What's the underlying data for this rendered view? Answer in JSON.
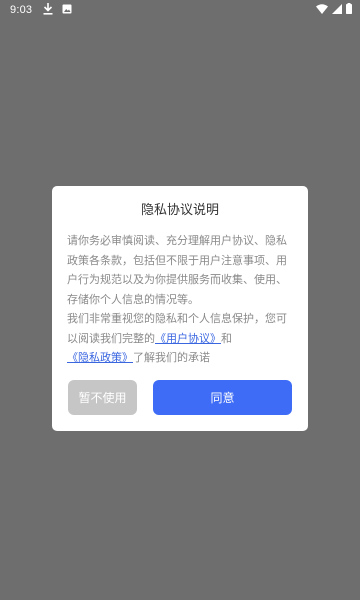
{
  "status_bar": {
    "time": "9:03",
    "icons": [
      "download-icon",
      "image-icon",
      "wifi-icon",
      "signal-icon",
      "battery-icon"
    ]
  },
  "dialog": {
    "title": "隐私协议说明",
    "paragraph1": "请你务必审慎阅读、充分理解用户协议、隐私政策各条款，包括但不限于用户注意事项、用户行为规范以及为你提供服务而收集、使用、存储你个人信息的情况等。",
    "paragraph2_prefix": "我们非常重视您的隐私和个人信息保护，您可以阅读我们完整的",
    "user_agreement_link": "《用户协议》",
    "connector": "和",
    "privacy_policy_link": "《隐私政策》",
    "paragraph2_suffix": "了解我们的承诺",
    "decline_label": "暂不使用",
    "agree_label": "同意"
  },
  "colors": {
    "overlay_background": "#6e6e6e",
    "dialog_background": "#ffffff",
    "link": "#3a66e0",
    "agree_button": "#3e6cf6",
    "decline_button": "#c6c6c6"
  }
}
